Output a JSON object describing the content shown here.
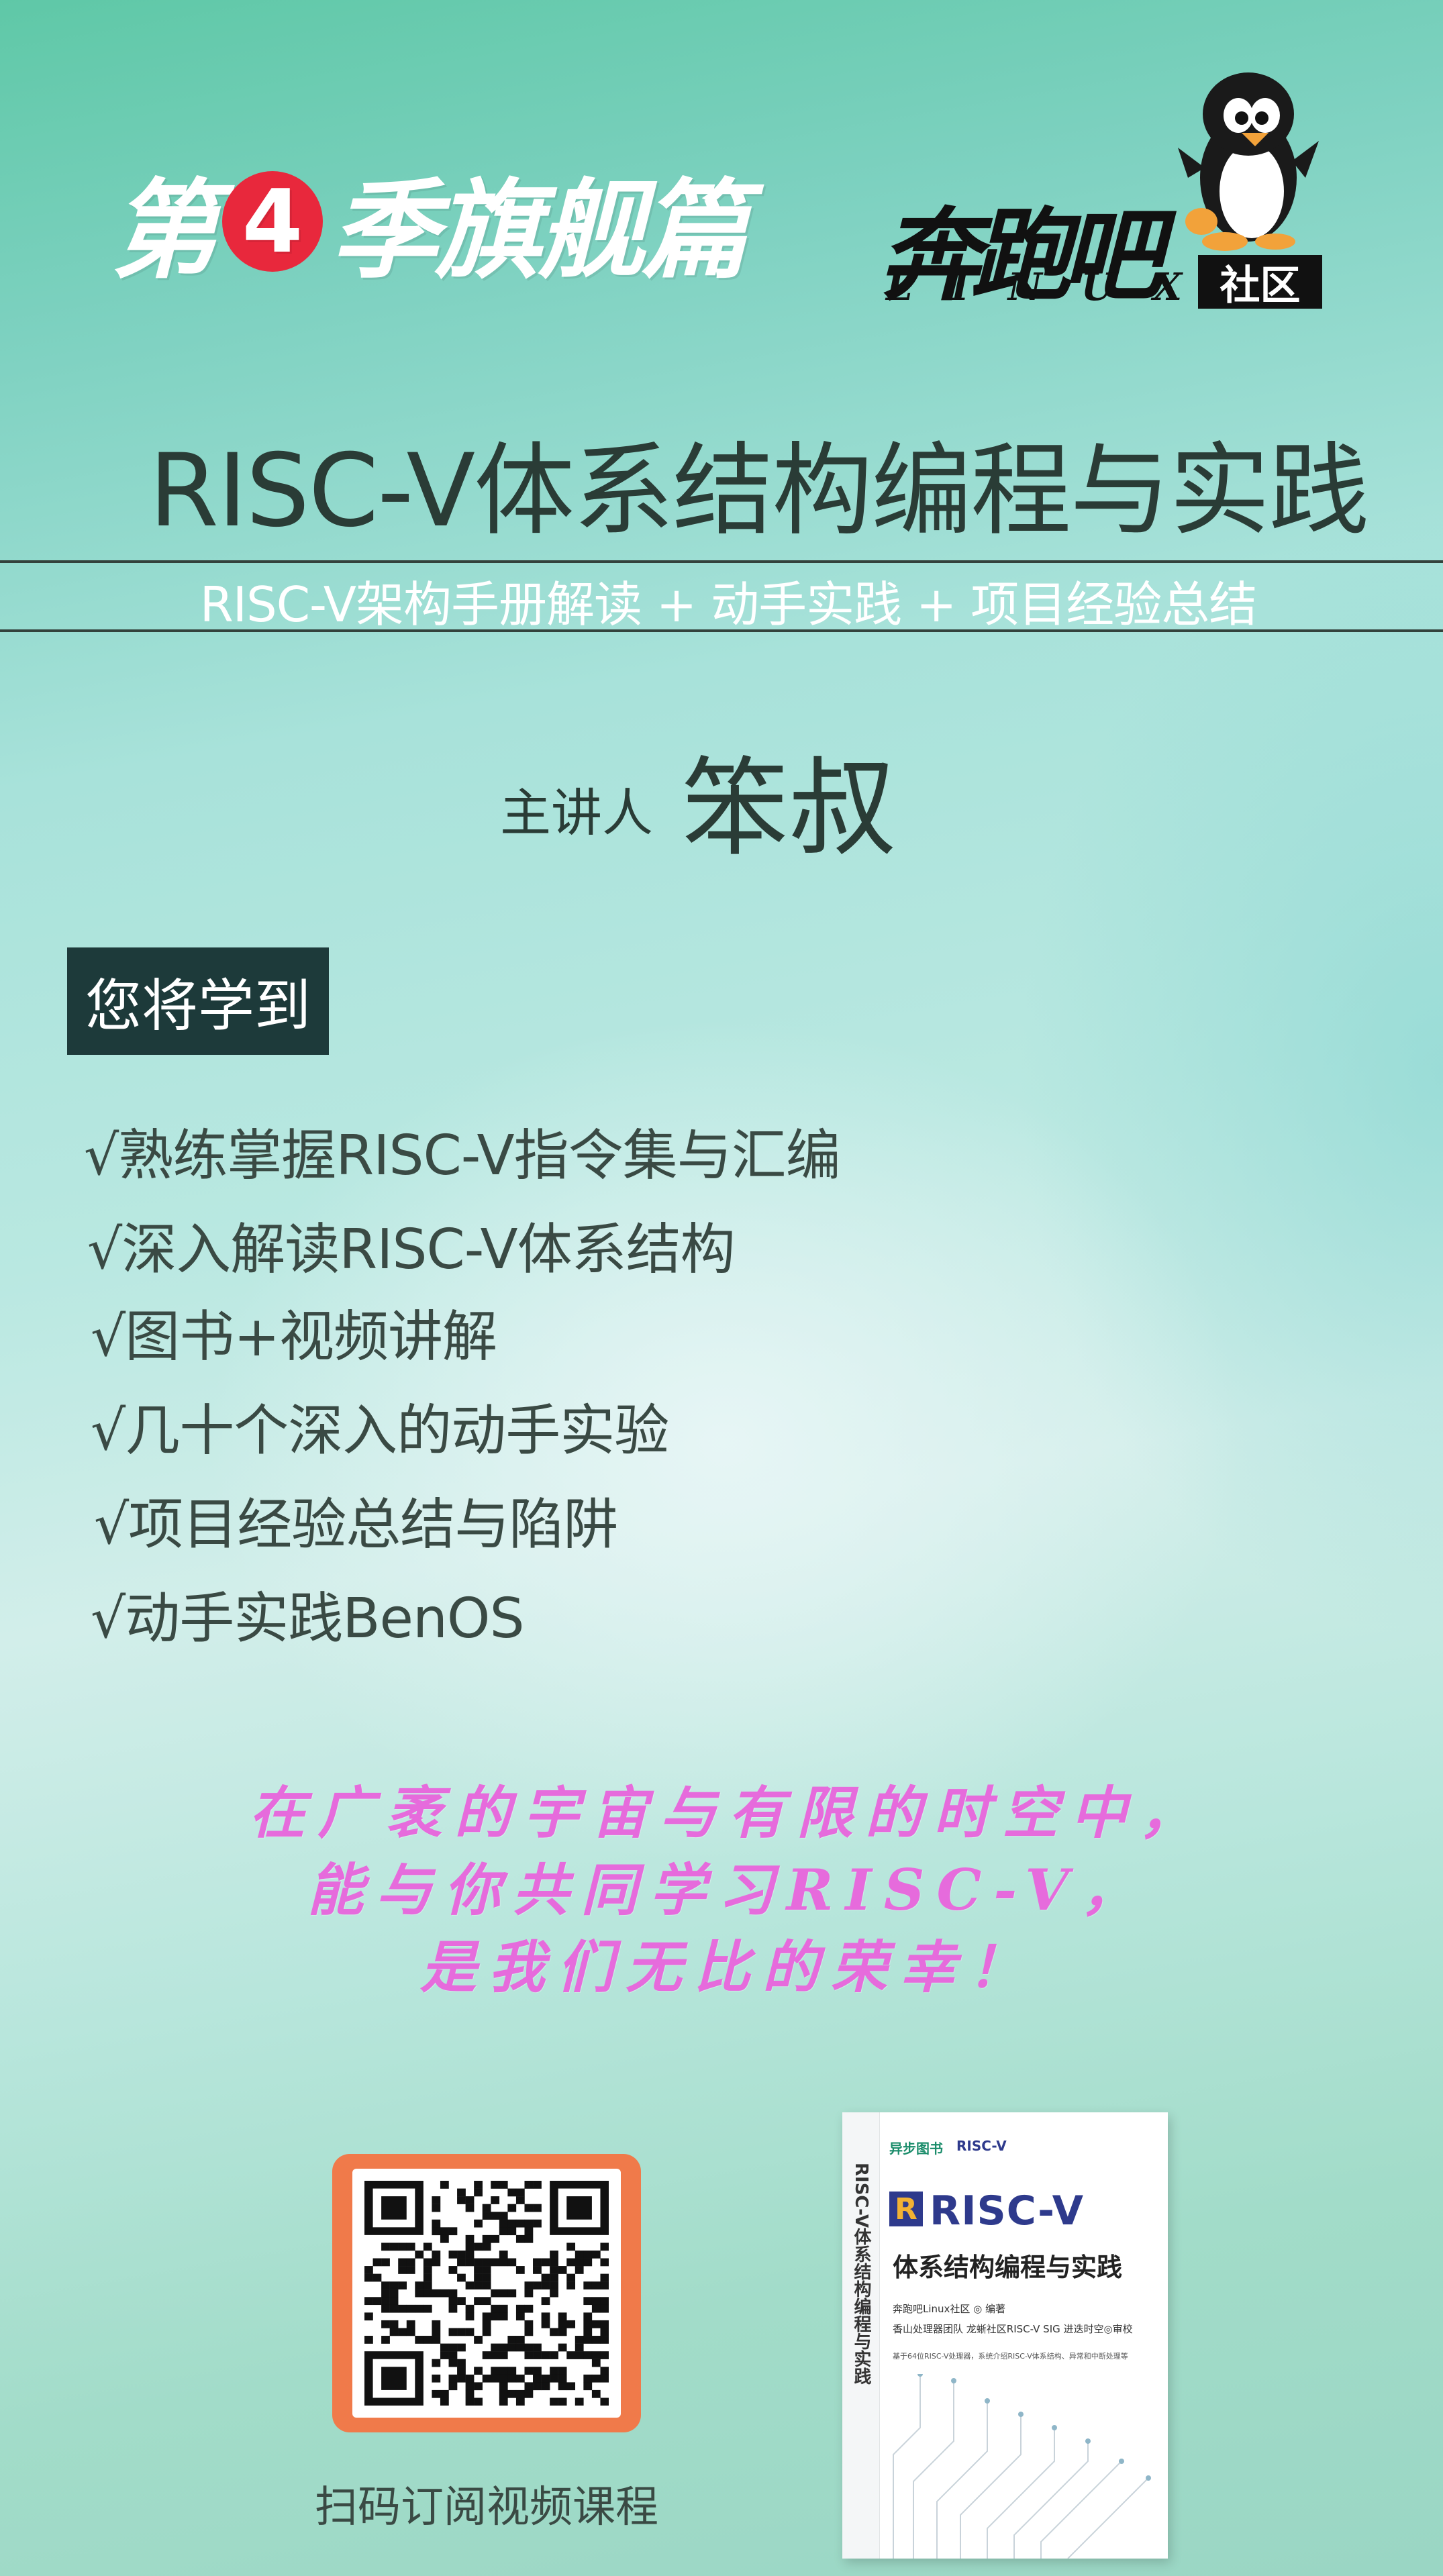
{
  "header": {
    "season_prefix": "第",
    "season_number": "4",
    "season_suffix": "季旗舰篇"
  },
  "logo": {
    "name": "奔跑吧",
    "linux": "LINUX",
    "community": "社区"
  },
  "title": "RISC-V体系结构编程与实践",
  "subtitle": "RISC-V架构手册解读 + 动手实践 + 项目经验总结",
  "speaker": {
    "label": "主讲人",
    "name": "笨叔"
  },
  "learn": {
    "heading": "您将学到",
    "items": [
      "√熟练掌握RISC-V指令集与汇编",
      "√深入解读RISC-V体系结构",
      "√图书+视频讲解",
      "√几十个深入的动手实验",
      "√项目经验总结与陷阱",
      "√动手实践BenOS"
    ]
  },
  "slogan": [
    "在广袤的宇宙与有限的时空中，",
    "能与你共同学习RISC-V，",
    "是我们无比的荣幸！"
  ],
  "qr": {
    "caption": "扫码订阅视频课程"
  },
  "book": {
    "publisher": "异步图书",
    "publisher2": "RISC-V",
    "brand_mark": "R",
    "brand": "RISC-V",
    "title": "体系结构编程与实践",
    "author": "奔跑吧Linux社区 ◎ 编著",
    "team": "香山处理器团队  龙蜥社区RISC-V SIG  进迭时空◎审校",
    "desc": "基于64位RISC-V处理器，系统介绍RISC-V体系结构、异常和中断处理等",
    "spine": "RISC-V体系结构编程与实践"
  },
  "colors": {
    "title": "#2a3c36",
    "accent_red": "#e8283c",
    "slogan": "#e66bdc",
    "learn_box": "#1d3a3a",
    "qr_frame": "#f07a4a"
  }
}
